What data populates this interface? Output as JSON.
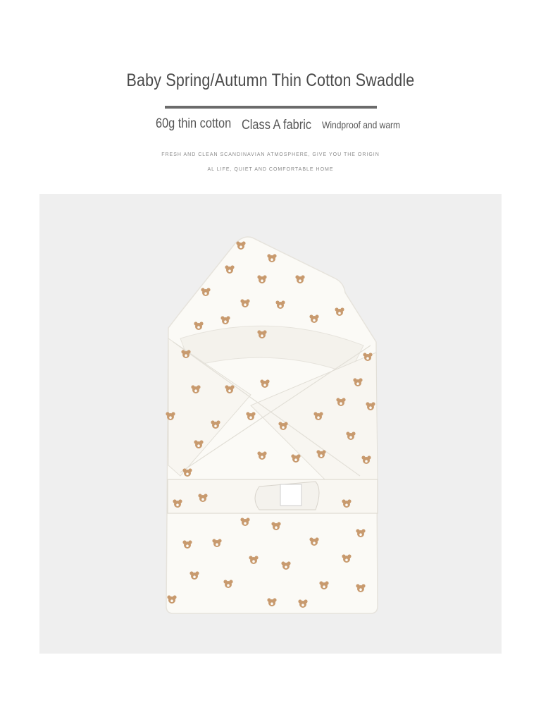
{
  "header": {
    "title": "Baby Spring/Autumn Thin Cotton Swaddle"
  },
  "features": [
    "60g thin cotton",
    "Class A fabric",
    "Windproof and warm"
  ],
  "tagline": {
    "line1": "FRESH AND CLEAN SCANDINAVIAN ATMOSPHERE, GIVE YOU THE ORIGIN",
    "line2": "AL LIFE, QUIET AND COMFORTABLE HOME"
  },
  "product_image": {
    "background_color": "#efefef",
    "fabric_color": "#fbfaf6",
    "print_color": "#c89a6e",
    "motif": "bear-face"
  }
}
